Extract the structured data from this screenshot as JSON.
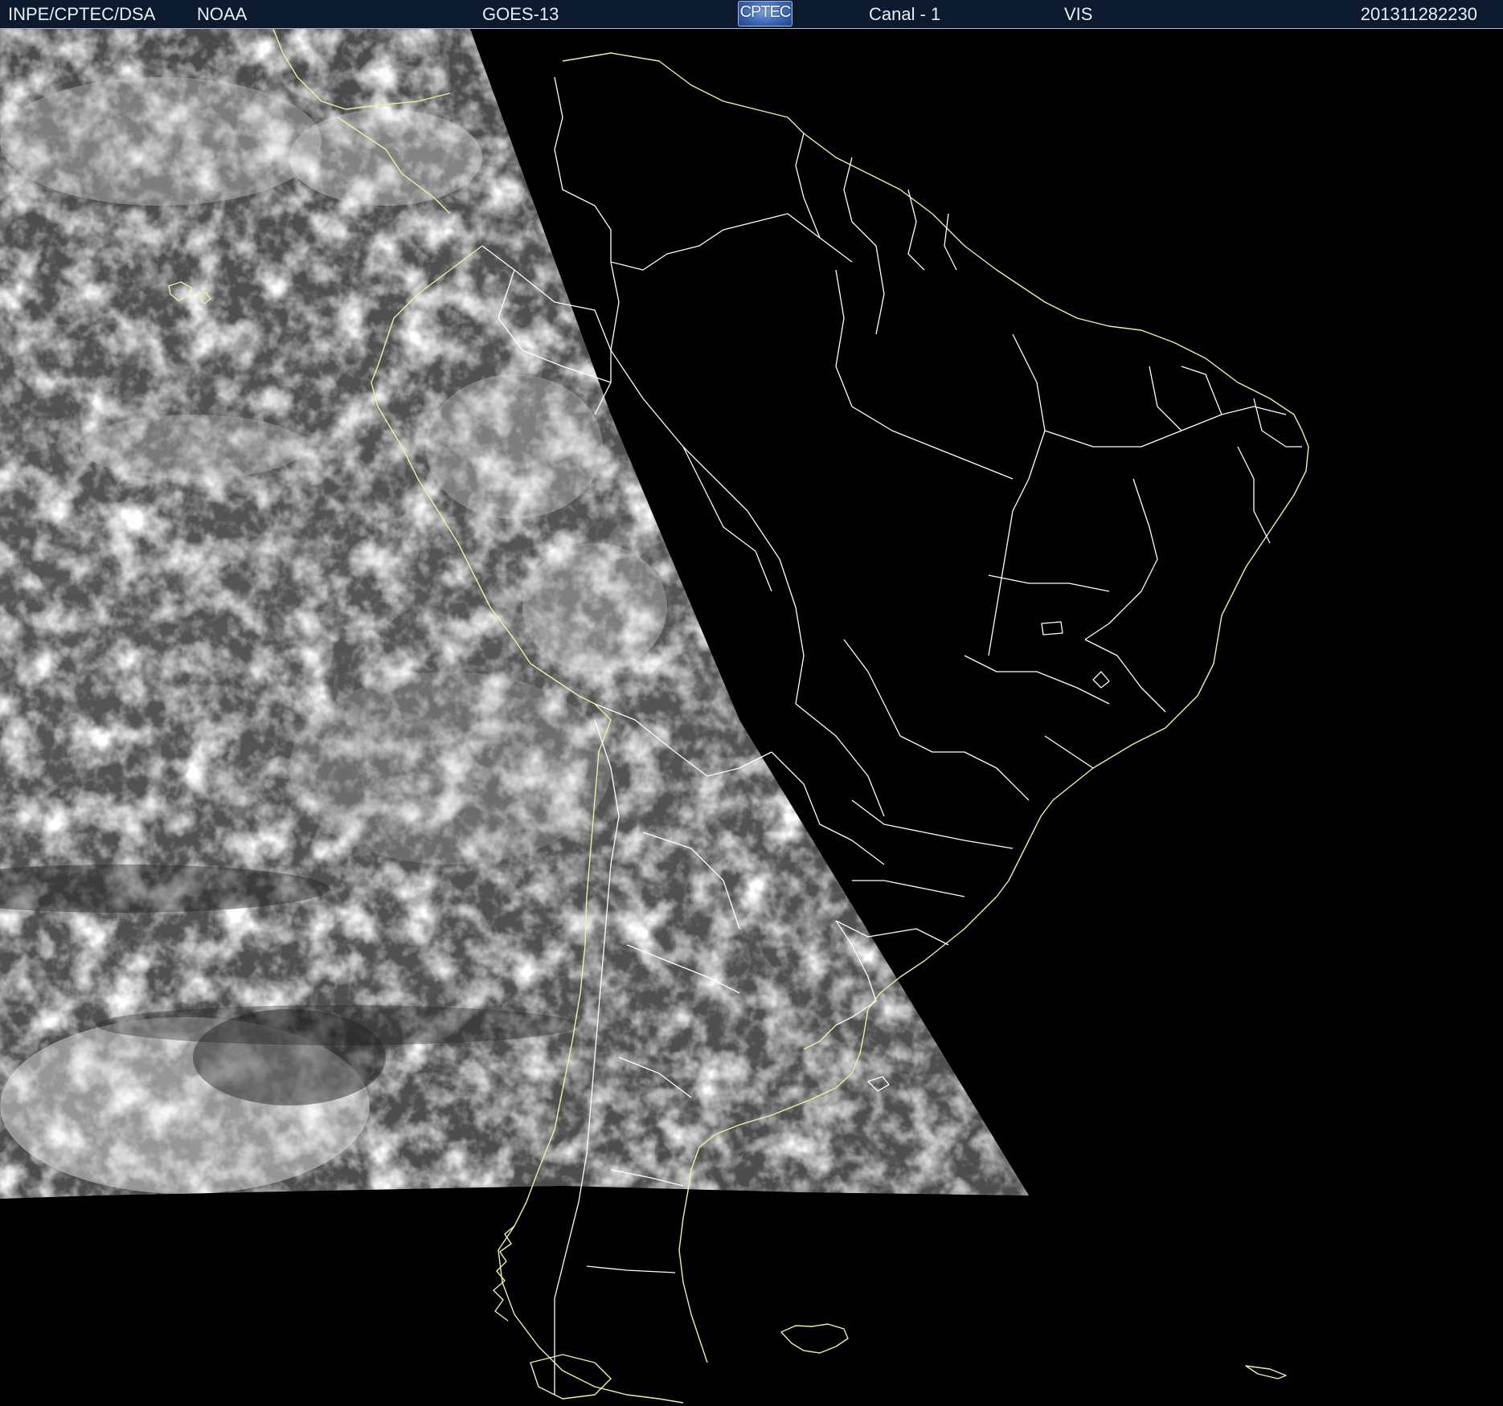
{
  "header": {
    "organization": "INPE/CPTEC/DSA",
    "agency": "NOAA",
    "satellite": "GOES-13",
    "logo_text": "CPTEC",
    "channel": "Canal - 1",
    "band": "VIS",
    "timestamp": "201311282230"
  },
  "map": {
    "imagery": "satellite-visible-channel",
    "coastline_color": "#eef0a8",
    "border_color": "#ffffff",
    "background_color": "#000000"
  }
}
